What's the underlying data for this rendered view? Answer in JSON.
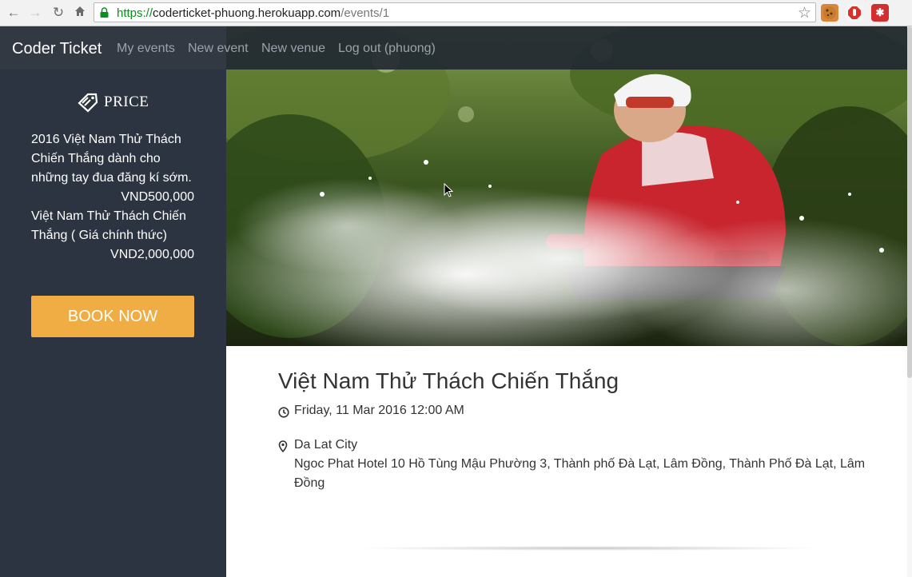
{
  "browser": {
    "url_scheme": "https://",
    "url_host": "coderticket-phuong.herokuapp.com",
    "url_path": "/events/1",
    "icons": [
      "back-arrow-icon",
      "forward-arrow-icon",
      "reload-icon",
      "home-icon",
      "lock-icon",
      "bookmark-star-icon"
    ],
    "extensions": [
      "cookie-extension-icon",
      "adblock-extension-icon",
      "lastpass-extension-icon"
    ]
  },
  "navbar": {
    "brand": "Coder Ticket",
    "links": [
      "My events",
      "New event",
      "New venue",
      "Log out (phuong)"
    ]
  },
  "sidebar": {
    "price_heading": "PRICE",
    "tickets": [
      {
        "name": "2016 Việt Nam Thử Thách Chiến Thắng dành cho những tay đua đăng kí sớm.",
        "price": "VND500,000"
      },
      {
        "name": "Việt Nam Thử Thách Chiến Thắng ( Giá chính thức)",
        "price": "VND2,000,000"
      }
    ],
    "book_label": "BOOK NOW"
  },
  "event": {
    "title": "Việt Nam Thử Thách Chiến Thắng",
    "datetime": "Friday, 11 Mar 2016 12:00 AM",
    "venue_name": "Da Lat City",
    "venue_address": "Ngoc Phat Hotel 10 Hồ Tùng Mậu Phường 3, Thành phố Đà Lạt, Lâm Đồng, Thành Phố Đà Lạt, Lâm Đồng",
    "hero_image": "mountain-biker-splashing-through-water"
  },
  "colors": {
    "sidebar_bg": "#2c3441",
    "navbar_bg": "#222832",
    "book_button": "#f0ad43",
    "url_scheme": "#0a8f1f"
  }
}
